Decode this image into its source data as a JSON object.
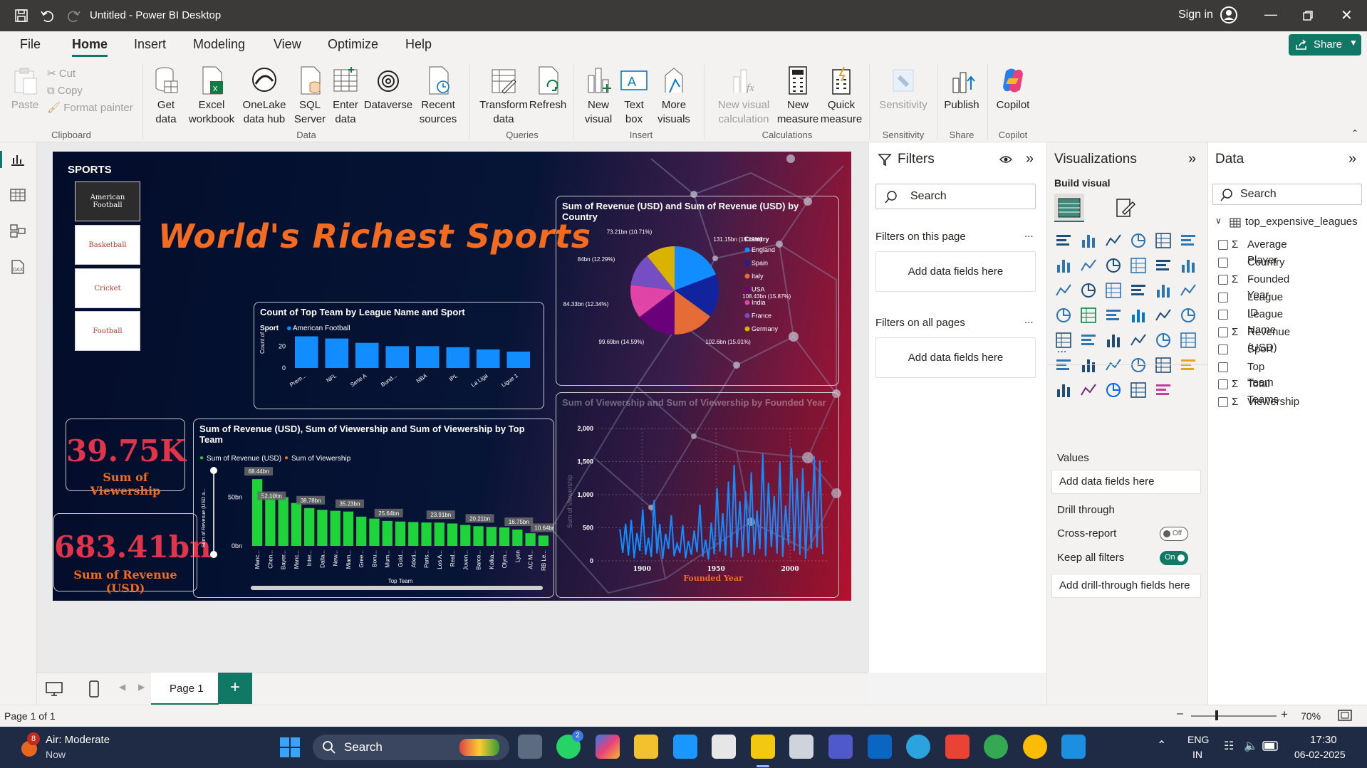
{
  "titlebar": {
    "title": "Untitled - Power BI Desktop",
    "sign_in": "Sign in"
  },
  "menu": {
    "items": [
      "File",
      "Home",
      "Insert",
      "Modeling",
      "View",
      "Optimize",
      "Help"
    ],
    "share": "Share"
  },
  "ribbon": {
    "clipboard": {
      "paste": "Paste",
      "cut": "Cut",
      "copy": "Copy",
      "format_painter": "Format painter",
      "group": "Clipboard"
    },
    "data": {
      "get_data": "Get\ndata",
      "excel": "Excel\nworkbook",
      "onelake": "OneLake\ndata hub",
      "sql": "SQL\nServer",
      "enter": "Enter\ndata",
      "dataverse": "Dataverse",
      "recent": "Recent\nsources",
      "group": "Data"
    },
    "queries": {
      "transform": "Transform\ndata",
      "refresh": "Refresh",
      "group": "Queries"
    },
    "insert": {
      "new_visual": "New\nvisual",
      "text_box": "Text\nbox",
      "more_visuals": "More\nvisuals",
      "group": "Insert"
    },
    "calculations": {
      "new_visual_calc": "New visual\ncalculation",
      "new_measure": "New\nmeasure",
      "quick_measure": "Quick\nmeasure",
      "group": "Calculations"
    },
    "sensitivity": {
      "label": "Sensitivity",
      "group": "Sensitivity"
    },
    "share": {
      "publish": "Publish",
      "group": "Share"
    },
    "copilot": {
      "label": "Copilot",
      "group": "Copilot"
    }
  },
  "report": {
    "slicer_title": "SPORTS",
    "slicer_items": [
      "American Football",
      "Basketball",
      "Cricket",
      "Football"
    ],
    "main_title": "World's Richest Sports",
    "kpi_viewership": {
      "value": "39.75K",
      "label": "Sum of Viewership"
    },
    "kpi_revenue": {
      "value": "683.41bn",
      "label": "Sum of Revenue (USD)"
    },
    "colors": {
      "accent_orange": "#f26b21",
      "kpi_red": "#e0344a",
      "bar_blue": "#118dff",
      "bar_green": "#1fd33b",
      "viewership_orange": "#f26b21"
    }
  },
  "bar_chart": {
    "title": "Count of Top Team by League Name and Sport",
    "legend_label": "Sport",
    "legend_item": "American Football",
    "ylabel": "Count of T...",
    "chart_data": {
      "type": "bar",
      "categories": [
        "Prem...",
        "NFL",
        "Serie A",
        "Bund...",
        "NBA",
        "IPL",
        "La Liga",
        "Ligue 1"
      ],
      "values": [
        29,
        27,
        23,
        20,
        20,
        19,
        17,
        15
      ],
      "ylim": [
        0,
        30
      ],
      "yticks": [
        "0",
        "20"
      ]
    }
  },
  "pie_chart": {
    "title": "Sum of Revenue (USD) and Sum of Revenue (USD) by Country",
    "legend_title": "Country",
    "chart_data": {
      "type": "pie",
      "labels": [
        "England",
        "Spain",
        "Italy",
        "USA",
        "India",
        "France",
        "Germany"
      ],
      "values": [
        131.15,
        108.43,
        102.6,
        99.69,
        84.33,
        84,
        73.21
      ],
      "colors": [
        "#118dff",
        "#12239e",
        "#e66c37",
        "#6b007b",
        "#e044a7",
        "#744ec2",
        "#d9b300"
      ],
      "data_labels": [
        "131.15bn (19.19%)",
        "108.43bn (15.87%)",
        "102.6bn (15.01%)",
        "99.69bn (14.59%)",
        "84.33bn (12.34%)",
        "84bn (12.29%)",
        "73.21bn (10.71%)"
      ]
    }
  },
  "combo_chart": {
    "title": "Sum of Revenue (USD), Sum of Viewership and Sum of Viewership by Top Team",
    "legend": [
      "Sum of Revenue (USD)",
      "Sum of Viewership"
    ],
    "ylabel": "Sum of Revenue (USD a...",
    "xlabel": "Top Team",
    "chart_data": {
      "type": "bar",
      "categories": [
        "Manc...",
        "Chen...",
        "Bayer...",
        "Manc...",
        "Inter...",
        "Dalla...",
        "New...",
        "Miam...",
        "Gree...",
        "Boru...",
        "Mum...",
        "Gold...",
        "Atleti...",
        "Paris...",
        "Los A...",
        "Real...",
        "Juven...",
        "Barce...",
        "Kolka...",
        "Olym...",
        "Lyon",
        "AC M...",
        "RB Le..."
      ],
      "values": [
        68.44,
        52.1,
        50,
        44,
        38.78,
        37,
        36,
        35.23,
        30,
        28,
        25.64,
        25,
        24.5,
        24,
        23.91,
        23,
        21.5,
        20.21,
        19.5,
        19,
        16.75,
        13,
        10.64
      ],
      "data_labels": [
        "68.44bn",
        "52.10bn",
        "38.78bn",
        "35.23bn",
        "25.64bn",
        "23.91bn",
        "20.21bn",
        "16.75bn",
        "10.64bn"
      ],
      "yticks": [
        "0bn",
        "50bn"
      ],
      "ylim": [
        0,
        70
      ]
    }
  },
  "line_chart": {
    "title": "Sum of Viewership and Sum of Viewership by Founded Year",
    "xlabel": "Founded Year",
    "ylabel": "Sum of Viewership",
    "chart_data": {
      "type": "line",
      "xticks": [
        "1900",
        "1950",
        "2000"
      ],
      "yticks": [
        "0",
        "500",
        "1,000",
        "1,500",
        "2,000"
      ],
      "xlim": [
        1870,
        2025
      ],
      "ylim": [
        0,
        2000
      ],
      "series": [
        {
          "values": [
            480,
            120,
            560,
            80,
            620,
            40,
            420,
            150,
            780,
            90,
            350,
            60,
            920,
            110,
            560,
            30,
            410,
            180,
            690,
            70,
            260,
            120,
            540,
            40,
            300,
            90,
            460,
            130,
            850,
            60,
            320,
            20,
            580,
            100,
            1100,
            140,
            720,
            80,
            1200,
            50,
            1450,
            200,
            900,
            60,
            1050,
            120,
            1340,
            90,
            760,
            180,
            1620,
            70,
            1180,
            210,
            980,
            110,
            1500,
            60,
            840,
            240,
            1700,
            150,
            1250,
            90,
            1400,
            30,
            1050,
            180,
            1580,
            200,
            1520,
            100
          ]
        }
      ]
    }
  },
  "filters": {
    "title": "Filters",
    "search": "Search",
    "on_page": "Filters on this page",
    "on_all": "Filters on all pages",
    "add": "Add data fields here",
    "more": "..."
  },
  "viz": {
    "title": "Visualizations",
    "build": "Build visual",
    "values": "Values",
    "add": "Add data fields here",
    "drill": "Drill through",
    "cross": "Cross-report",
    "cross_state": "Off",
    "keep": "Keep all filters",
    "keep_state": "On",
    "add_drill": "Add drill-through fields here",
    "more": "..."
  },
  "data_pane": {
    "title": "Data",
    "search": "Search",
    "table": "top_expensive_leagues",
    "fields": [
      {
        "name": "Average Player ...",
        "sigma": true
      },
      {
        "name": "Country",
        "sigma": false
      },
      {
        "name": "Founded Year",
        "sigma": true
      },
      {
        "name": "League ID",
        "sigma": false
      },
      {
        "name": "League Name",
        "sigma": false
      },
      {
        "name": "Revenue (USD)",
        "sigma": true
      },
      {
        "name": "Sport",
        "sigma": false
      },
      {
        "name": "Top Team",
        "sigma": false
      },
      {
        "name": "Total Teams",
        "sigma": true
      },
      {
        "name": "Viewership",
        "sigma": true
      }
    ]
  },
  "pages": {
    "tab": "Page 1",
    "add": "+"
  },
  "status": {
    "page": "Page 1 of 1",
    "zoom": "70%"
  },
  "taskbar": {
    "weather": "Air: Moderate",
    "weather_time": "Now",
    "weather_badge": "8",
    "search": "Search",
    "lang1": "ENG",
    "lang2": "IN",
    "time": "17:30",
    "date": "06-02-2025",
    "whatsapp_badge": "2"
  }
}
